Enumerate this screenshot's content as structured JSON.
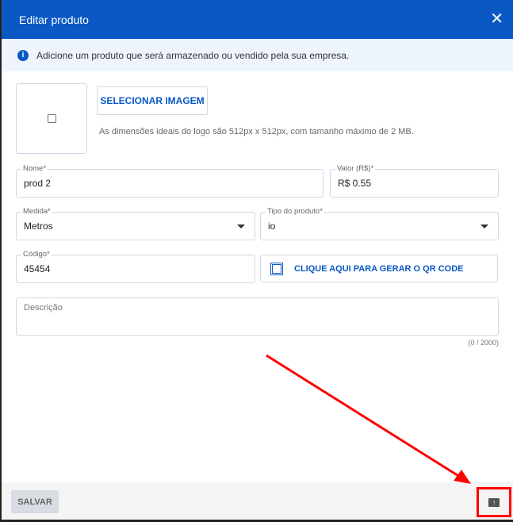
{
  "header": {
    "title": "Editar produto",
    "close_icon": "close-icon"
  },
  "info": {
    "text": "Adicione um produto que será armazenado ou vendido pela sua empresa."
  },
  "image": {
    "button": "SELECIONAR IMAGEM",
    "hint": "As dimensões ideais do logo são 512px x 512px, com tamanho máximo de 2 MB."
  },
  "fields": {
    "nome": {
      "label": "Nome*",
      "value": "prod 2"
    },
    "valor": {
      "label": "Valor (R$)*",
      "value": "R$ 0.55"
    },
    "medida": {
      "label": "Medida*",
      "value": "Metros"
    },
    "tipo": {
      "label": "Tipo do produto*",
      "value": "io"
    },
    "codigo": {
      "label": "Código*",
      "value": "45454"
    },
    "descricao": {
      "placeholder": "Descrição",
      "counter": "(0 / 2000)"
    }
  },
  "qr_button": "CLIQUE AQUI PARA GERAR O QR CODE",
  "footer": {
    "save": "SALVAR"
  },
  "colors": {
    "primary": "#0a58c4",
    "annotation": "#ff0000"
  }
}
